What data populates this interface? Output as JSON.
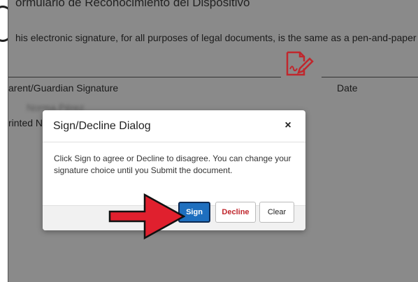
{
  "document": {
    "title": "ormulario de Reconocimiento del Dispositivo",
    "statement": "his electronic signature, for all purposes of legal documents, is the same as a pen-and-paper",
    "signature_label": "arent/Guardian Signature",
    "date_label": "Date",
    "printed_name_value": "Norma Pérez",
    "printed_name_label": "rinted N"
  },
  "dialog": {
    "title": "Sign/Decline Dialog",
    "close_glyph": "×",
    "message": "Click Sign to agree or Decline to disagree. You can change your signature choice until you Submit the document.",
    "buttons": {
      "sign": "Sign",
      "decline": "Decline",
      "clear": "Clear"
    }
  },
  "icons": {
    "signature": "signature-document-icon",
    "arrow": "red-pointer-arrow"
  },
  "colors": {
    "sign_button": "#1e6fbf",
    "decline_text": "#c0272d",
    "signature_icon": "#c0272d",
    "arrow": "#e0202e",
    "overlay": "#8a8a8a"
  }
}
